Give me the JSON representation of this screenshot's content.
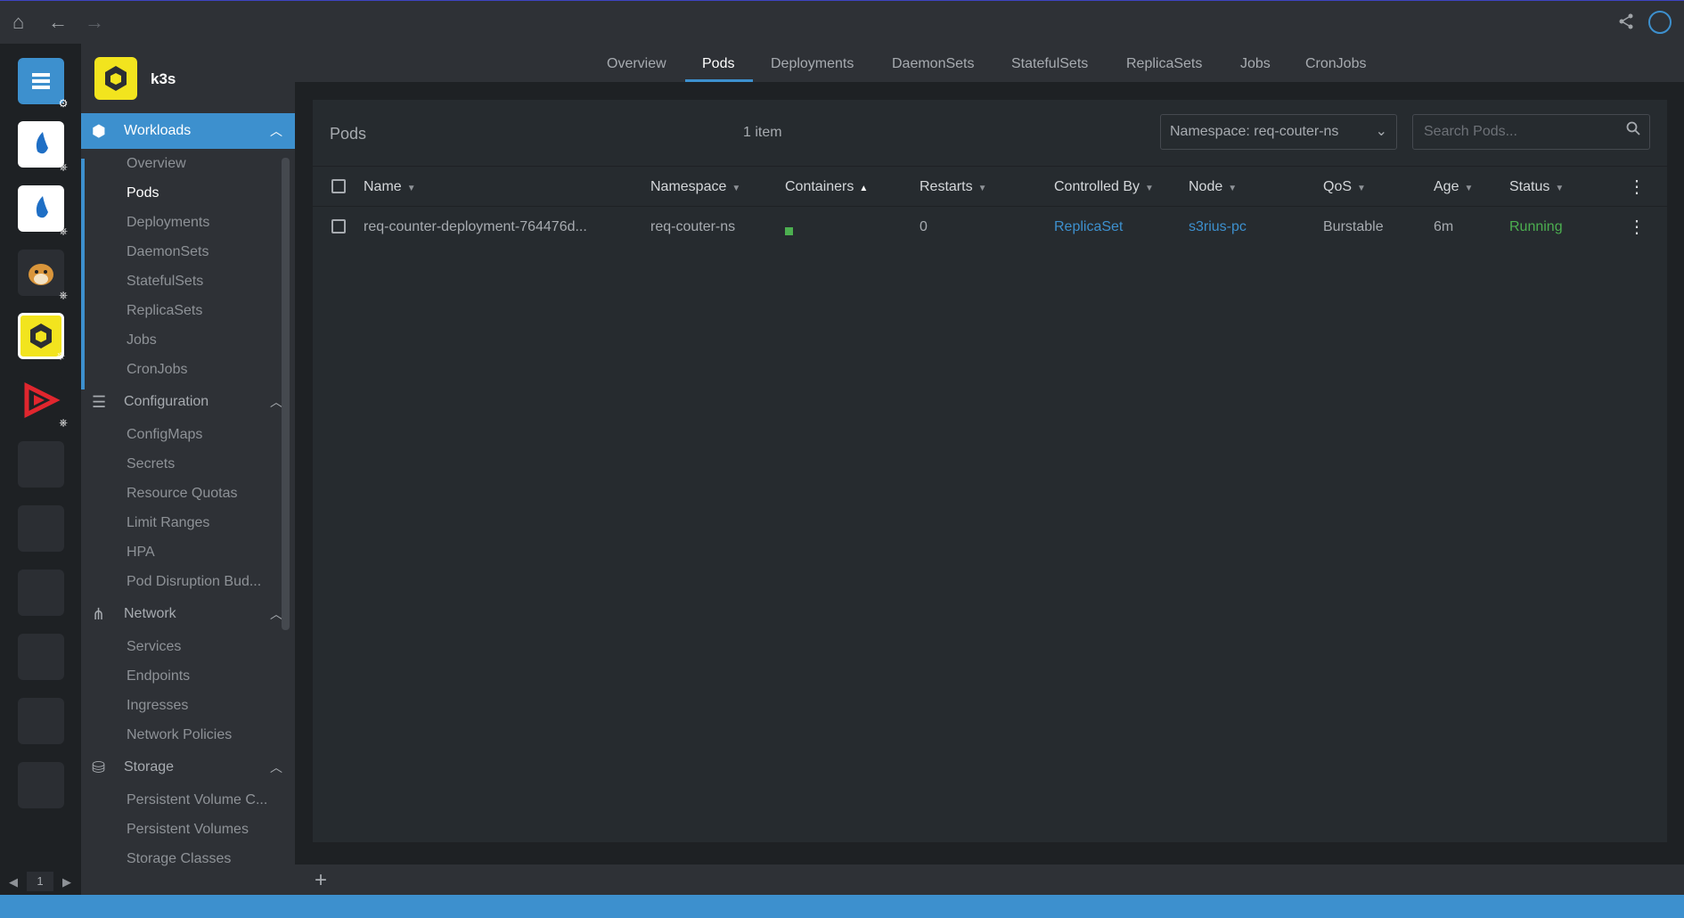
{
  "topbar": {
    "home": "⌂",
    "back": "←",
    "forward": "→",
    "share": "⤴"
  },
  "hotbar": {
    "page": "1",
    "prev": "◀",
    "next": "▶"
  },
  "cluster": {
    "name": "k3s"
  },
  "sidebar": {
    "workloads": {
      "label": "Workloads",
      "items": [
        "Overview",
        "Pods",
        "Deployments",
        "DaemonSets",
        "StatefulSets",
        "ReplicaSets",
        "Jobs",
        "CronJobs"
      ]
    },
    "configuration": {
      "label": "Configuration",
      "items": [
        "ConfigMaps",
        "Secrets",
        "Resource Quotas",
        "Limit Ranges",
        "HPA",
        "Pod Disruption Bud..."
      ]
    },
    "network": {
      "label": "Network",
      "items": [
        "Services",
        "Endpoints",
        "Ingresses",
        "Network Policies"
      ]
    },
    "storage": {
      "label": "Storage",
      "items": [
        "Persistent Volume C...",
        "Persistent Volumes",
        "Storage Classes"
      ]
    }
  },
  "tabs": [
    "Overview",
    "Pods",
    "Deployments",
    "DaemonSets",
    "StatefulSets",
    "ReplicaSets",
    "Jobs",
    "CronJobs"
  ],
  "panel": {
    "title": "Pods",
    "count": "1 item",
    "namespace_select": "Namespace: req-couter-ns",
    "search_placeholder": "Search Pods..."
  },
  "table": {
    "columns": [
      "Name",
      "Namespace",
      "Containers",
      "Restarts",
      "Controlled By",
      "Node",
      "QoS",
      "Age",
      "Status"
    ],
    "rows": [
      {
        "name": "req-counter-deployment-764476d...",
        "namespace": "req-couter-ns",
        "restarts": "0",
        "controlled_by": "ReplicaSet",
        "node": "s3rius-pc",
        "qos": "Burstable",
        "age": "6m",
        "status": "Running"
      }
    ]
  },
  "dock": {
    "add": "+"
  },
  "colors": {
    "accent": "#3d90ce",
    "running": "#4caf50",
    "cluster_logo": "#f2e41e"
  }
}
